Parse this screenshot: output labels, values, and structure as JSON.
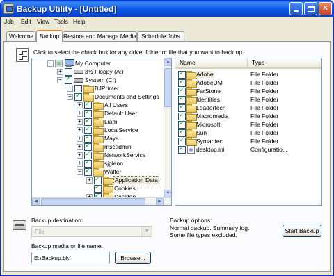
{
  "window": {
    "title": "Backup Utility - [Untitled]"
  },
  "menu": [
    "Job",
    "Edit",
    "View",
    "Tools",
    "Help"
  ],
  "tabs": [
    "Welcome",
    "Backup",
    "Restore and Manage Media",
    "Schedule Jobs"
  ],
  "instruction": "Click to select the check box for any drive, folder or file that you want to back up.",
  "tree": [
    {
      "label": "My Computer"
    },
    {
      "label": "3½ Floppy (A:)"
    },
    {
      "label": "System (C:)"
    },
    {
      "label": "BJPrinter"
    },
    {
      "label": "Documents and Settings"
    },
    {
      "label": "All Users"
    },
    {
      "label": "Default User"
    },
    {
      "label": "Liam"
    },
    {
      "label": "LocalService"
    },
    {
      "label": "Maya"
    },
    {
      "label": "mscadmin"
    },
    {
      "label": "NetworkService"
    },
    {
      "label": "sjglenn"
    },
    {
      "label": "Walter"
    },
    {
      "label": "Application Data"
    },
    {
      "label": "Cookies"
    },
    {
      "label": "Desktop"
    }
  ],
  "list": {
    "columns": [
      "Name",
      "Type"
    ],
    "rows": [
      {
        "name": "Adobe",
        "type": "File Folder"
      },
      {
        "name": "AdobeUM",
        "type": "File Folder"
      },
      {
        "name": "FarStone",
        "type": "File Folder"
      },
      {
        "name": "Identities",
        "type": "File Folder"
      },
      {
        "name": "Leadertech",
        "type": "File Folder"
      },
      {
        "name": "Macromedia",
        "type": "File Folder"
      },
      {
        "name": "Microsoft",
        "type": "File Folder"
      },
      {
        "name": "Sun",
        "type": "File Folder"
      },
      {
        "name": "Symantec",
        "type": "File Folder"
      },
      {
        "name": "desktop.ini",
        "type": "Configuratio..."
      }
    ]
  },
  "bottom": {
    "destination_label": "Backup destination:",
    "destination_value": "File",
    "media_label": "Backup media or file name:",
    "media_value": "E:\\Backup.bkf",
    "browse_label": "Browse...",
    "options_title": "Backup options:",
    "options_line1": "Normal backup.  Summary log.",
    "options_line2": "Some file types excluded.",
    "start_label": "Start Backup"
  }
}
